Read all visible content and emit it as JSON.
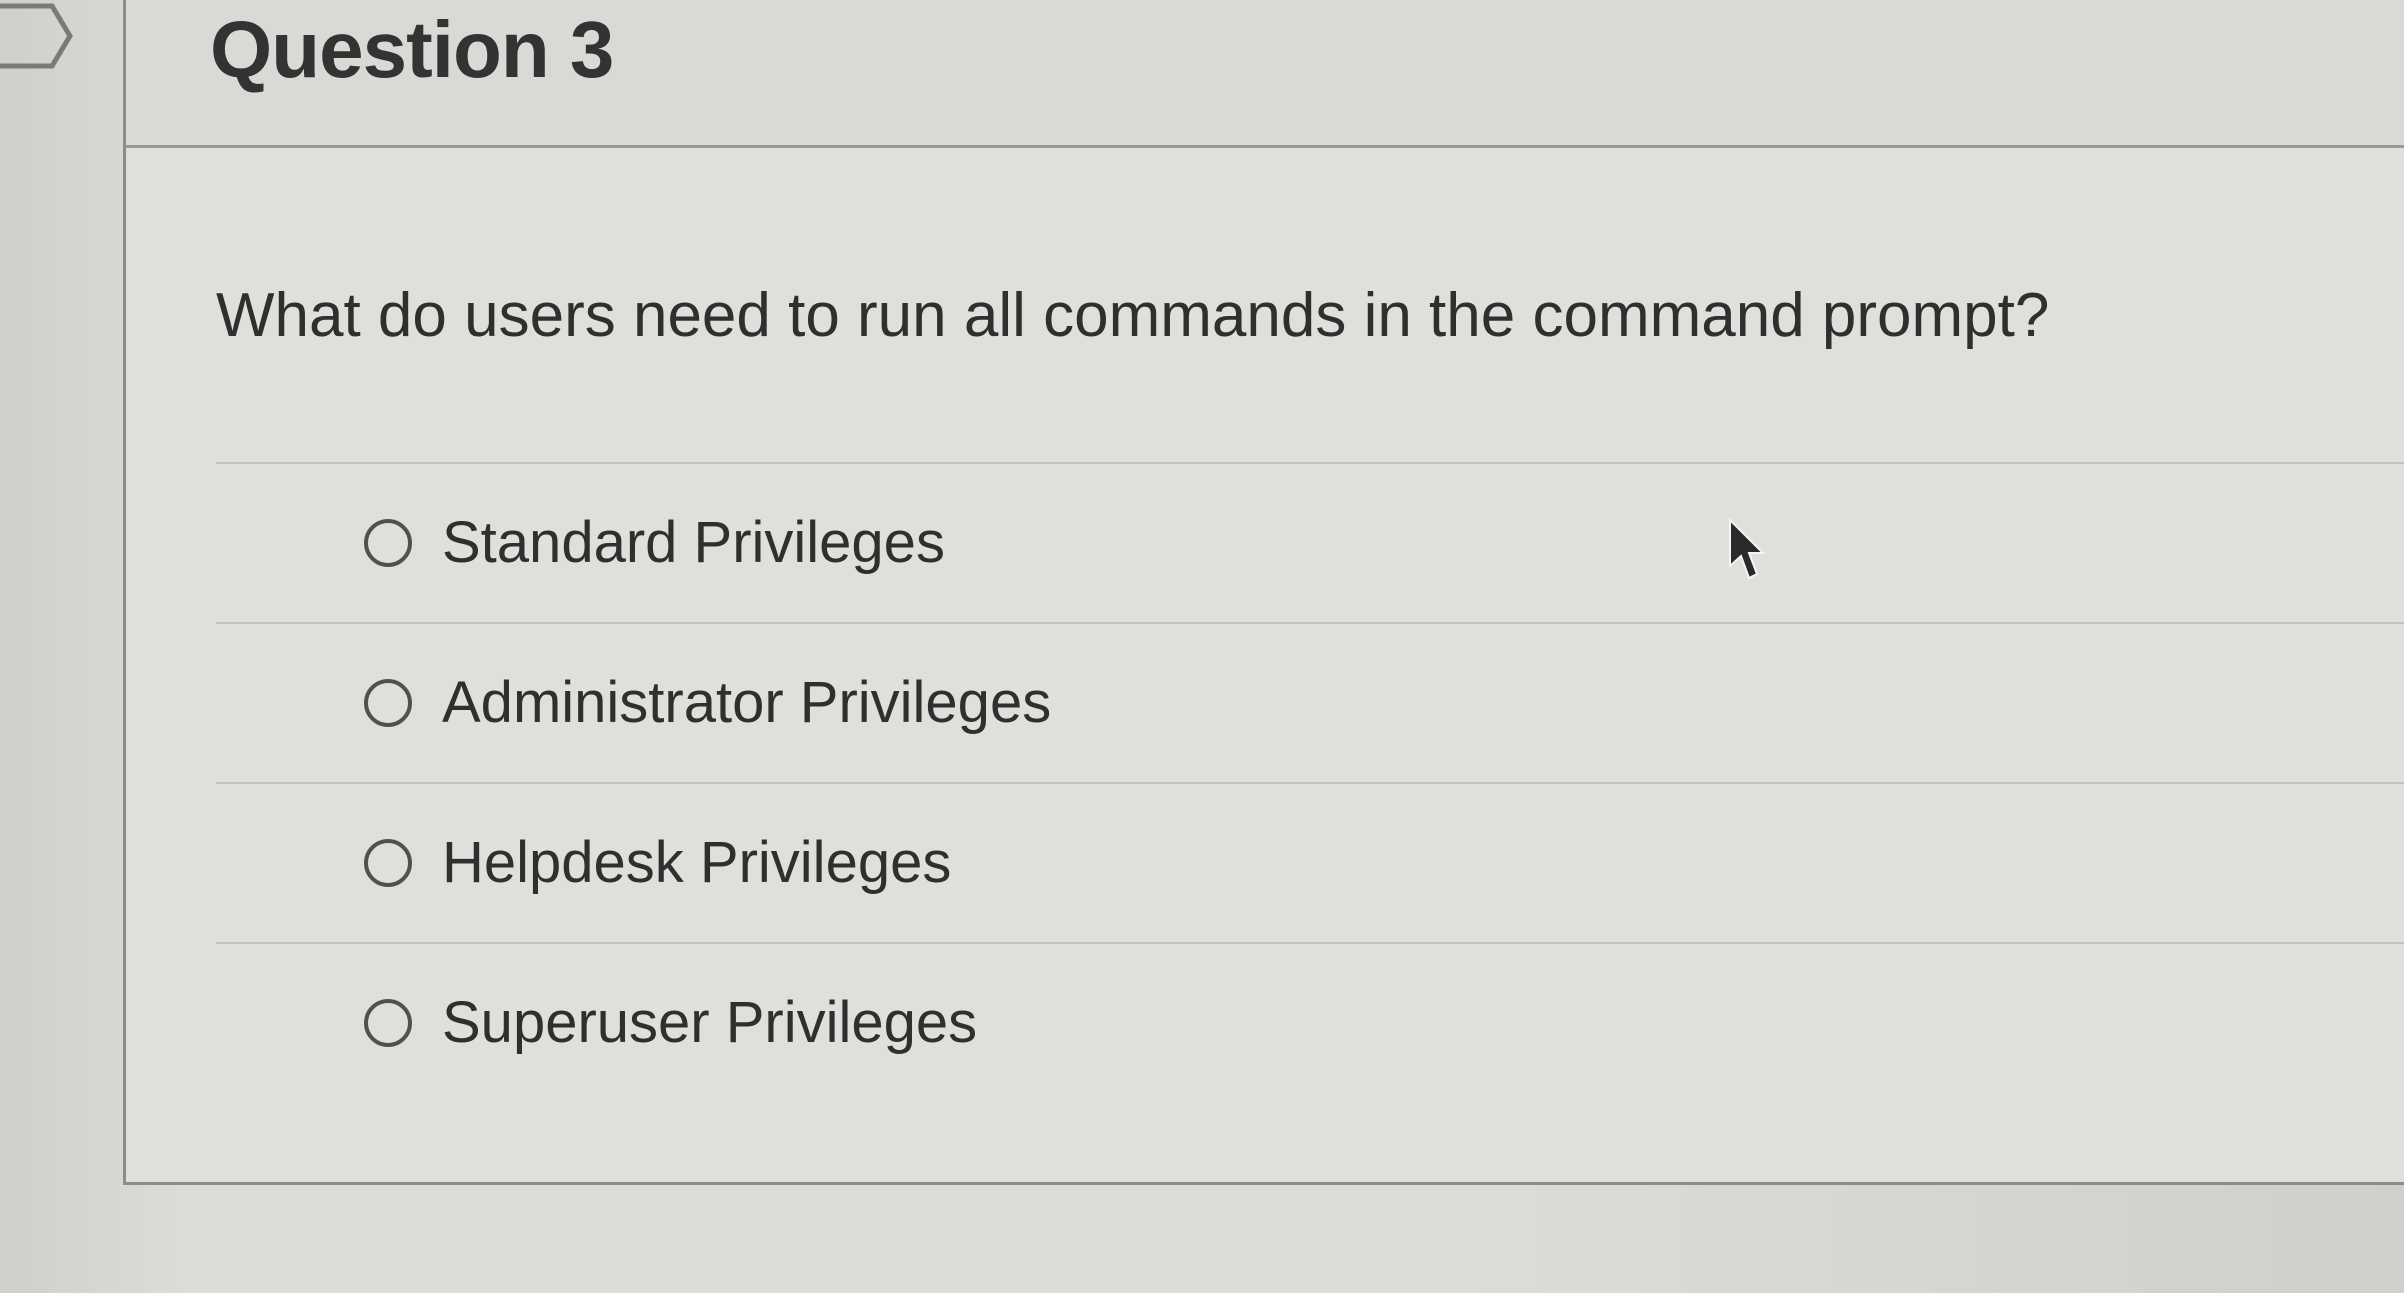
{
  "question": {
    "title": "Question 3",
    "prompt": "What do users need to run all commands in the command prompt?"
  },
  "answers": [
    {
      "label": "Standard Privileges",
      "selected": false
    },
    {
      "label": "Administrator Privileges",
      "selected": false
    },
    {
      "label": "Helpdesk Privileges",
      "selected": false
    },
    {
      "label": "Superuser Privileges",
      "selected": false
    }
  ],
  "icons": {
    "flag": "flag-icon",
    "cursor": "mouse-cursor-icon"
  },
  "colors": {
    "text": "#2f2f2f",
    "divider": "#c4c4c1",
    "radio_border": "#505050"
  }
}
